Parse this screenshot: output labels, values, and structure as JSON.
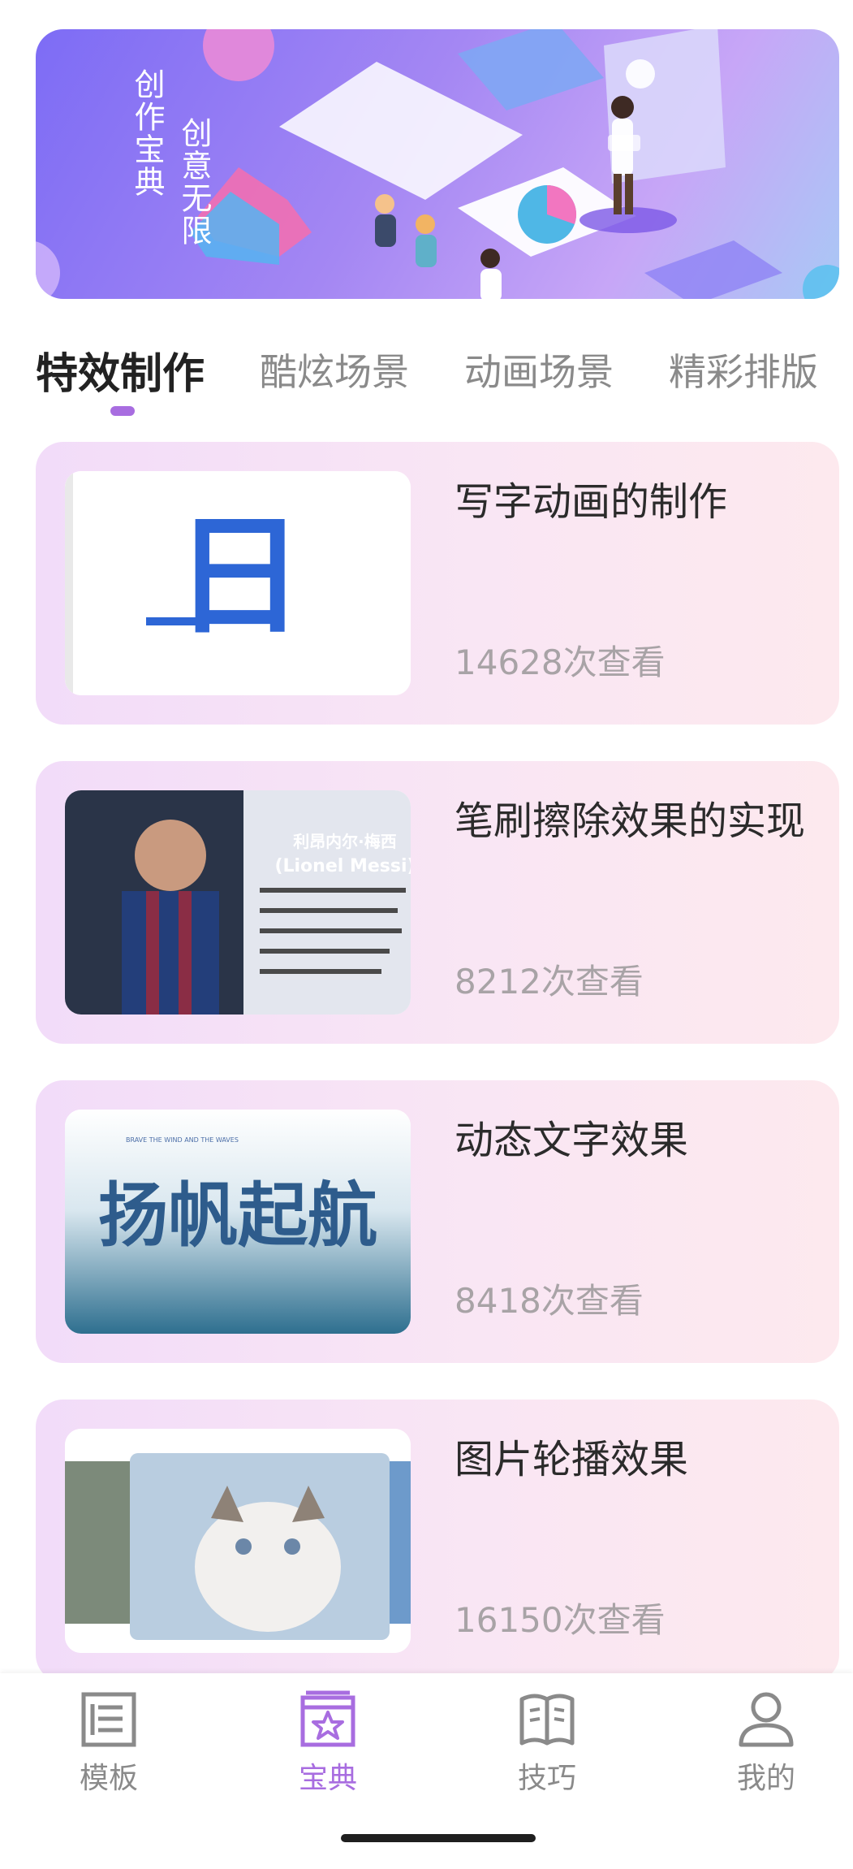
{
  "banner": {
    "line1": "创作宝典",
    "line2": "创意无限"
  },
  "tabs": [
    {
      "label": "特效制作",
      "active": true
    },
    {
      "label": "酷炫场景",
      "active": false
    },
    {
      "label": "动画场景",
      "active": false
    },
    {
      "label": "精彩排版",
      "active": false
    }
  ],
  "cards": [
    {
      "title": "写字动画的制作",
      "views": "14628次查看",
      "thumb_text": "日"
    },
    {
      "title": "笔刷擦除效果的实现",
      "views": "8212次查看",
      "thumb_text": "利昂内尔·梅西",
      "thumb_subtitle": "(Lionel Messi)"
    },
    {
      "title": "动态文字效果",
      "views": "8418次查看",
      "thumb_text": "扬帆起航",
      "thumb_caption": "BRAVE THE WIND AND THE WAVES"
    },
    {
      "title": "图片轮播效果",
      "views": "16150次查看"
    }
  ],
  "bottom_nav": [
    {
      "label": "模板",
      "icon": "template-icon",
      "active": false
    },
    {
      "label": "宝典",
      "icon": "handbook-icon",
      "active": true
    },
    {
      "label": "技巧",
      "icon": "book-icon",
      "active": false
    },
    {
      "label": "我的",
      "icon": "profile-icon",
      "active": false
    }
  ],
  "colors": {
    "accent": "#a86de0",
    "tab_inactive": "#8a8a8a",
    "views_text": "#a8a3a6"
  }
}
